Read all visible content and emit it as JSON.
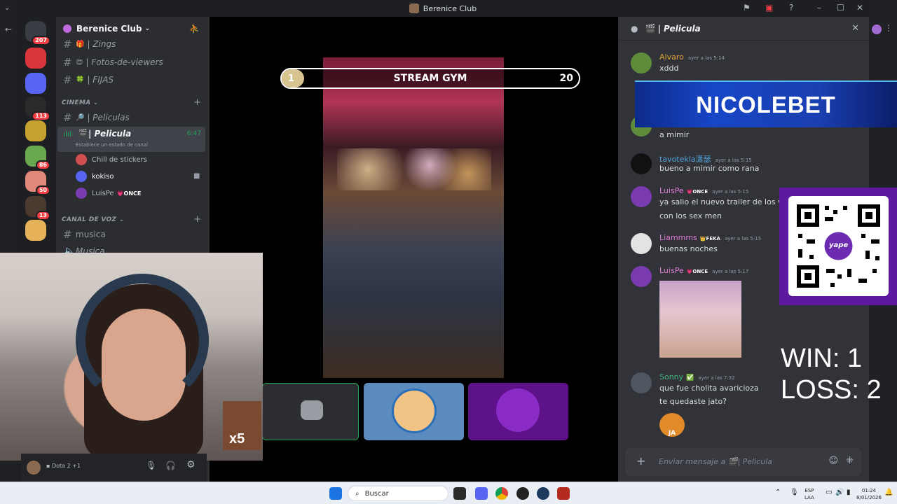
{
  "window": {
    "title": "Berenice Club"
  },
  "servers": [
    {
      "name": "discord-home",
      "badge": "207",
      "color": "#3b3d44"
    },
    {
      "name": "lg-server",
      "badge": "",
      "color": "#d9353d"
    },
    {
      "name": "discord-server",
      "badge": "",
      "color": "#5865f2"
    },
    {
      "name": "pets-server",
      "badge": "113",
      "color": "#2a2a2a"
    },
    {
      "name": "gold-server",
      "badge": "",
      "color": "#c8a231"
    },
    {
      "name": "friend-server",
      "badge": "86",
      "color": "#6aa84f"
    },
    {
      "name": "girl-server",
      "badge": "50",
      "color": "#e0887a"
    },
    {
      "name": "dark-server",
      "badge": "13",
      "color": "#4a3a30"
    },
    {
      "name": "kid-server",
      "badge": "",
      "color": "#e7b35a"
    }
  ],
  "sidebar": {
    "guild": "Berenice Club",
    "channels_top": [
      {
        "emoji": "🎁",
        "name": "| Zings"
      },
      {
        "emoji": "😍",
        "name": "| Fotos-de-viewers"
      },
      {
        "emoji": "🍀",
        "name": "| FIJAS"
      }
    ],
    "cat_cinema": "CINEMA",
    "peliculas": {
      "emoji": "🔎",
      "name": "| Peliculas"
    },
    "active_voice": {
      "emoji": "🎬",
      "name": "| Pelicula",
      "time": "6:47",
      "status": "Establece un estado de canal"
    },
    "voice_users": [
      {
        "name": "Chill de stickers",
        "tag": "",
        "color": "#d34f4f"
      },
      {
        "name": "kokiso",
        "tag": "",
        "color": "#5865f2"
      },
      {
        "name": "LuisPe",
        "tag": "ONCE",
        "color": "#7a3bb0"
      }
    ],
    "cat_voz": "CANAL DE VOZ",
    "musica": "musica",
    "musica2": "Musica",
    "user_game": "Dota 2 +1"
  },
  "stage": {
    "gym_left": "1",
    "gym_title": "STREAM GYM",
    "gym_right": "20"
  },
  "chat": {
    "channel": "| Pelicula",
    "messages": [
      {
        "user": "Alvaro",
        "color": "#e0a33a",
        "time": "ayer a las 5:14",
        "role": "",
        "lines": [
          "xddd"
        ]
      },
      {
        "user": "",
        "color": "#dbdee1",
        "time": "",
        "role": "",
        "lines": [
          "a mimir"
        ]
      },
      {
        "user": "tavotekla潇瑟",
        "color": "#4fa3d8",
        "time": "ayer a las 5:15",
        "role": "",
        "lines": [
          "bueno a mimir como rana"
        ]
      },
      {
        "user": "LuisPe",
        "color": "#e07bd6",
        "time": "ayer a las 5:15",
        "role": "ONCE",
        "lines": [
          "ya salio el nuevo trailer de los verga",
          "con los sex men"
        ]
      },
      {
        "user": "Liammms",
        "color": "#e07bd6",
        "time": "ayer a las 5:15",
        "role": "FEKA",
        "lines": [
          "buenas noches"
        ]
      },
      {
        "user": "LuisPe",
        "color": "#e07bd6",
        "time": "ayer a las 5:17",
        "role": "ONCE",
        "lines": []
      },
      {
        "user": "Sonny",
        "color": "#43b581",
        "time": "ayer a las 7:32",
        "role": "",
        "lines": [
          "que fue cholita avaricioza",
          "te quedaste jato?"
        ]
      }
    ],
    "sticker_label": "JA",
    "placeholder": "Enviar mensaje a",
    "placeholder_channel": "| Pelicula"
  },
  "overlays": {
    "nicolebet": "NICOLEBET",
    "score_win": "WIN: 1",
    "score_loss": "LOSS: 2",
    "qr_label": "yape",
    "combo": "x5"
  },
  "taskbar": {
    "search": "Buscar",
    "lang1": "ESP",
    "lang2": "LAA",
    "time": "01:24",
    "date": "8/01/2026"
  }
}
